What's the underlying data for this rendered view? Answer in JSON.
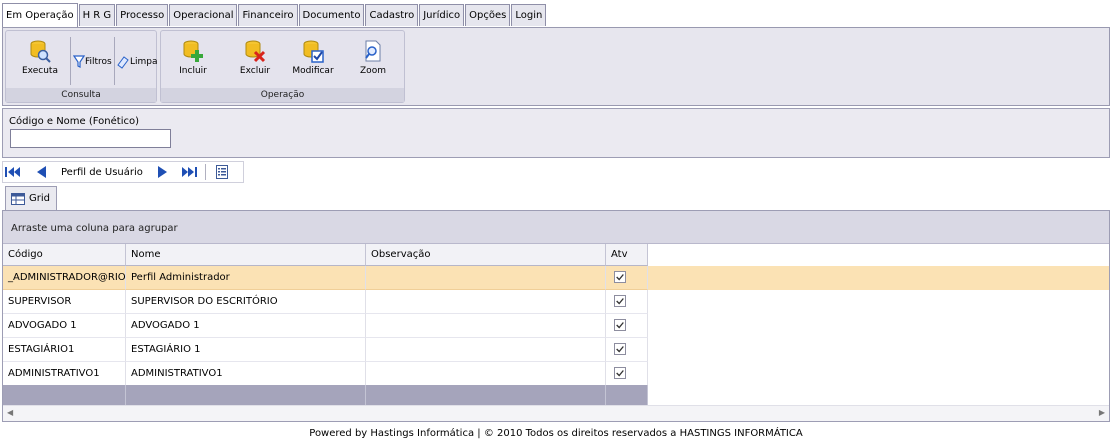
{
  "tabs": [
    {
      "label": "Em Operação",
      "active": true
    },
    {
      "label": "H R G"
    },
    {
      "label": "Processo"
    },
    {
      "label": "Operacional"
    },
    {
      "label": "Financeiro"
    },
    {
      "label": "Documento"
    },
    {
      "label": "Cadastro"
    },
    {
      "label": "Jurídico"
    },
    {
      "label": "Opções"
    },
    {
      "label": "Login"
    }
  ],
  "ribbon": {
    "consulta": {
      "label": "Consulta",
      "executa": "Executa",
      "filtros": "Filtros",
      "limpa": "Limpa"
    },
    "operacao": {
      "label": "Operação",
      "incluir": "Incluir",
      "excluir": "Excluir",
      "modificar": "Modificar",
      "zoom": "Zoom"
    }
  },
  "filter": {
    "label": "Código e Nome (Fonético)",
    "value": ""
  },
  "navigator": {
    "title": "Perfil de Usuário"
  },
  "grid": {
    "tab_label": "Grid",
    "group_hint": "Arraste uma coluna para agrupar",
    "columns": [
      "Código",
      "Nome",
      "Observação",
      "Atv"
    ],
    "rows": [
      {
        "codigo": "_ADMINISTRADOR@RIO",
        "nome": "Perfil Administrador",
        "obs": "",
        "atv": true,
        "selected": true
      },
      {
        "codigo": "SUPERVISOR",
        "nome": "SUPERVISOR DO ESCRITÓRIO",
        "obs": "",
        "atv": true
      },
      {
        "codigo": "ADVOGADO 1",
        "nome": "ADVOGADO 1",
        "obs": "",
        "atv": true
      },
      {
        "codigo": "ESTAGIÁRIO1",
        "nome": "ESTAGIÁRIO 1",
        "obs": "",
        "atv": true
      },
      {
        "codigo": "ADMINISTRATIVO1",
        "nome": "ADMINISTRATIVO1",
        "obs": "",
        "atv": true
      }
    ]
  },
  "footer": "Powered by Hastings Informática | © 2010 Todos os direitos reservados a HASTINGS INFORMÁTICA",
  "colors": {
    "selected_row": "#fbe2b4",
    "ribbon_bg": "#e7e6ee",
    "grid_footer": "#a5a4bb",
    "nav_blue": "#1f4fb4"
  }
}
